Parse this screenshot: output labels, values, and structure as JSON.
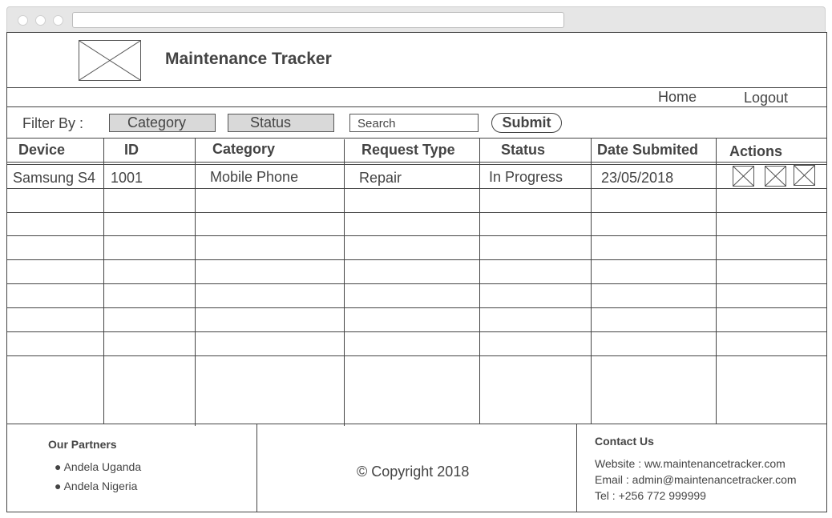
{
  "header": {
    "title": "Maintenance Tracker"
  },
  "nav": {
    "home": "Home",
    "logout": "Logout"
  },
  "filter": {
    "label": "Filter By :",
    "category": "Category",
    "status": "Status",
    "search_placeholder": "Search",
    "submit": "Submit"
  },
  "table": {
    "columns": [
      "Device",
      "ID",
      "Category",
      "Request Type",
      "Status",
      "Date Submited",
      "Actions"
    ],
    "rows": [
      [
        "Samsung S4",
        "1001",
        "Mobile Phone",
        "Repair",
        "In Progress",
        "23/05/2018"
      ]
    ]
  },
  "footer": {
    "partners_heading": "Our Partners",
    "partners": [
      "Andela Uganda",
      "Andela Nigeria"
    ],
    "copyright": "© Copyright 2018",
    "contact_heading": "Contact Us",
    "website": "Website : ww.maintenancetracker.com",
    "email": "Email : admin@maintenancetracker.com",
    "tel": "Tel : +256 772 999999"
  },
  "icons": {
    "logo": "image-placeholder-icon",
    "actions": [
      "view-icon",
      "edit-icon",
      "delete-icon"
    ]
  }
}
